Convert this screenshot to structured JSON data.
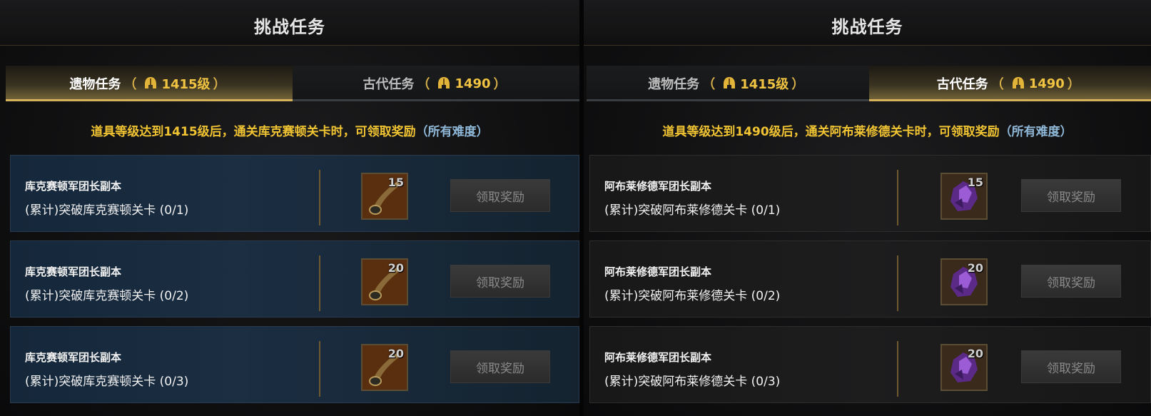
{
  "colors": {
    "gold": "#f0c332",
    "difficulty_blue": "#8fb8d8",
    "tab_active_underline": "#d6b25a"
  },
  "left_panel": {
    "title": "挑战任务",
    "tabs": [
      {
        "label": "遗物任务",
        "open": "（",
        "icon": "helmet-icon",
        "level": "1415级",
        "close": "）",
        "active": true
      },
      {
        "label": "古代任务",
        "open": "（",
        "icon": "helmet-icon",
        "level": "1490",
        "close": "）",
        "active": false
      }
    ],
    "condition": {
      "main": "道具等级达到1415级后，通关库克赛顿关卡时，可领取奖励",
      "difficulty": "（所有难度）"
    },
    "tasks": [
      {
        "name": "库克赛顿军团长副本",
        "desc": "(累计)突破库克赛顿关卡 (0/1)",
        "reward_icon": "horn-icon",
        "reward_count": "15",
        "button": "领取奖励"
      },
      {
        "name": "库克赛顿军团长副本",
        "desc": "(累计)突破库克赛顿关卡 (0/2)",
        "reward_icon": "horn-icon",
        "reward_count": "20",
        "button": "领取奖励"
      },
      {
        "name": "库克赛顿军团长副本",
        "desc": "(累计)突破库克赛顿关卡 (0/3)",
        "reward_icon": "horn-icon",
        "reward_count": "20",
        "button": "领取奖励"
      }
    ]
  },
  "right_panel": {
    "title": "挑战任务",
    "tabs": [
      {
        "label": "遗物任务",
        "open": "（",
        "icon": "helmet-icon",
        "level": "1415级",
        "close": "）",
        "active": false
      },
      {
        "label": "古代任务",
        "open": "（",
        "icon": "helmet-icon",
        "level": "1490",
        "close": "）",
        "active": true
      }
    ],
    "condition": {
      "main": "道具等级达到1490级后，通关阿布莱修德关卡时，可领取奖励",
      "difficulty": "（所有难度）"
    },
    "tasks": [
      {
        "name": "阿布莱修德军团长副本",
        "desc": "(累计)突破阿布莱修德关卡 (0/1)",
        "reward_icon": "purple-crystal-icon",
        "reward_count": "15",
        "button": "领取奖励"
      },
      {
        "name": "阿布莱修德军团长副本",
        "desc": "(累计)突破阿布莱修德关卡 (0/2)",
        "reward_icon": "purple-crystal-icon",
        "reward_count": "20",
        "button": "领取奖励"
      },
      {
        "name": "阿布莱修德军团长副本",
        "desc": "(累计)突破阿布莱修德关卡 (0/3)",
        "reward_icon": "purple-crystal-icon",
        "reward_count": "20",
        "button": "领取奖励"
      }
    ]
  }
}
